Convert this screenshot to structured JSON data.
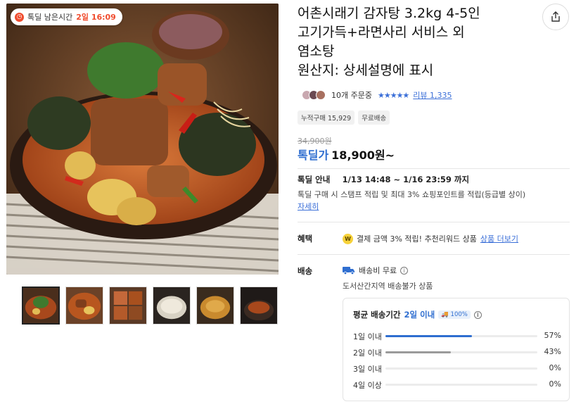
{
  "deal_timer": {
    "label": "톡딜 남은시간",
    "value": "2일 16:09"
  },
  "product": {
    "title_lines": [
      "어촌시래기 감자탕 3.2kg 4-5인",
      "고기가득+라면사리 서비스 외",
      "염소탕",
      "원산지: 상세설명에 표시"
    ]
  },
  "rating": {
    "orders": "10개 주문중",
    "stars": "★★★★★",
    "review_label": "리뷰 1,335"
  },
  "chips": [
    "누적구매 15,929",
    "무료배송"
  ],
  "price": {
    "original": "34,900원",
    "deal_label": "톡딜가",
    "deal_price": "18,900원~"
  },
  "deal_info": {
    "label": "톡딜 안내",
    "period": "1/13 14:48 ~ 1/16 23:59 까지",
    "description": "톡딜 구매 시 스탬프 적립 및 최대 3% 쇼핑포인트를 적립(등급별 상이)",
    "more_link": "자세히"
  },
  "benefit": {
    "label": "혜택",
    "coin_icon": "coin-icon",
    "text": "결제 금액 3% 적립! 추천리워드 상품",
    "link": "상품 더보기"
  },
  "shipping": {
    "label": "배송",
    "fee": "배송비 무료",
    "note": "도서산간지역 배송불가 상품",
    "avg_title": "평균 배송기간",
    "avg_value": "2일 이내",
    "avg_badge": "100%",
    "distribution": [
      {
        "label": "1일 이내",
        "percent": 57,
        "display": "57%",
        "color": "#2f6ed0"
      },
      {
        "label": "2일 이내",
        "percent": 43,
        "display": "43%",
        "color": "#9a9a9a"
      },
      {
        "label": "3일 이내",
        "percent": 0,
        "display": "0%",
        "color": "#9a9a9a"
      },
      {
        "label": "4일 이상",
        "percent": 0,
        "display": "0%",
        "color": "#9a9a9a"
      }
    ]
  },
  "thumbnails": [
    "thumbnail-1",
    "thumbnail-2",
    "thumbnail-3",
    "thumbnail-4",
    "thumbnail-5",
    "thumbnail-6"
  ],
  "colors": {
    "accent": "#2f6ed0",
    "timer": "#f04b2d"
  }
}
